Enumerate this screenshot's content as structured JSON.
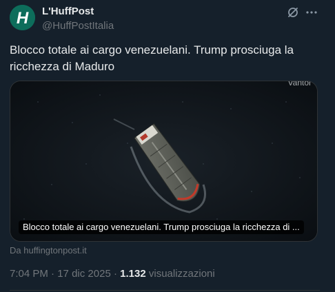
{
  "author": {
    "name": "L'HuffPost",
    "handle": "@HuffPostItalia",
    "avatar_letter": "H",
    "avatar_color": "#0d6d5b"
  },
  "tweet": {
    "text": "Blocco totale ai cargo venezuelani. Trump prosciuga la ricchezza di Maduro"
  },
  "card": {
    "watermark": "Vantor",
    "title": "Blocco totale ai cargo venezuelani. Trump prosciuga la ricchezza di ...",
    "source": "Da huffingtonpost.it"
  },
  "meta": {
    "time": "7:04 PM",
    "separator": " · ",
    "date": "17 dic 2025",
    "views_count": "1.132",
    "views_label": " visualizzazioni"
  },
  "icons": {
    "grok": "grok-icon",
    "more": "more-icon"
  },
  "colors": {
    "background": "#15202b",
    "text_primary": "#e7e9ea",
    "text_secondary": "#71767b",
    "border": "#2f3336"
  }
}
